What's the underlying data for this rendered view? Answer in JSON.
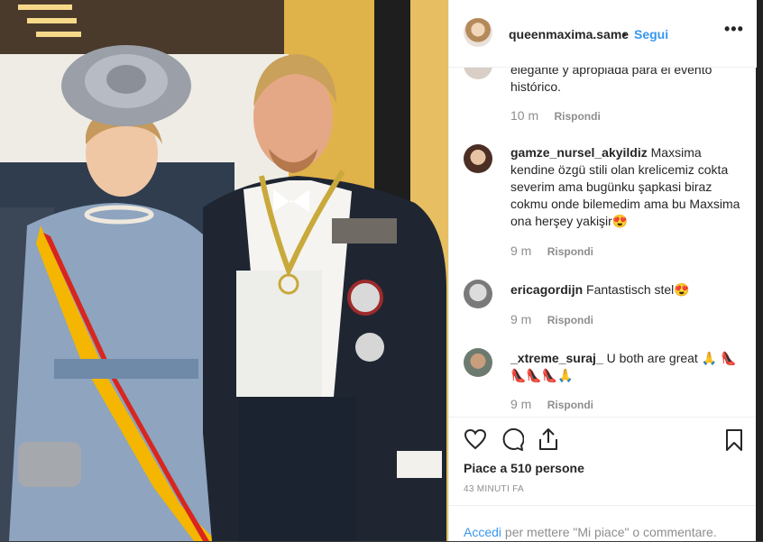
{
  "header": {
    "username": "queenmaxima.same",
    "separator": "•",
    "follow_label": "Segui",
    "more_label": "•••"
  },
  "comments": [
    {
      "username": "",
      "text": "elegante y apropiada para el evento histórico.",
      "time": "10 m",
      "reply_label": "Rispondi"
    },
    {
      "username": "gamze_nursel_akyildiz",
      "text": "Maxsima kendine özgü stili olan krelicemiz cokta severim ama bugünku şapkasi biraz cokmu onde bilemedim ama bu Maxsima ona herşey yakişir😍",
      "time": "9 m",
      "reply_label": "Rispondi"
    },
    {
      "username": "ericagordijn",
      "text": "Fantastisch stel😍",
      "time": "9 m",
      "reply_label": "Rispondi"
    },
    {
      "username": "_xtreme_suraj_",
      "text": "U both are great 🙏 👠👠👠👠🙏",
      "time": "9 m",
      "reply_label": "Rispondi"
    }
  ],
  "actions": {
    "like_icon": "heart-icon",
    "comment_icon": "comment-icon",
    "share_icon": "share-icon",
    "save_icon": "bookmark-icon",
    "likes_text": "Piace a 510 persone",
    "time_ago": "43 MINUTI FA"
  },
  "login": {
    "link_label": "Accedi",
    "rest_text": " per mettere \"Mi piace\" o commentare."
  },
  "colors": {
    "link": "#3897f0",
    "text": "#262626",
    "muted": "#8e8e8e",
    "border": "#efefef"
  }
}
